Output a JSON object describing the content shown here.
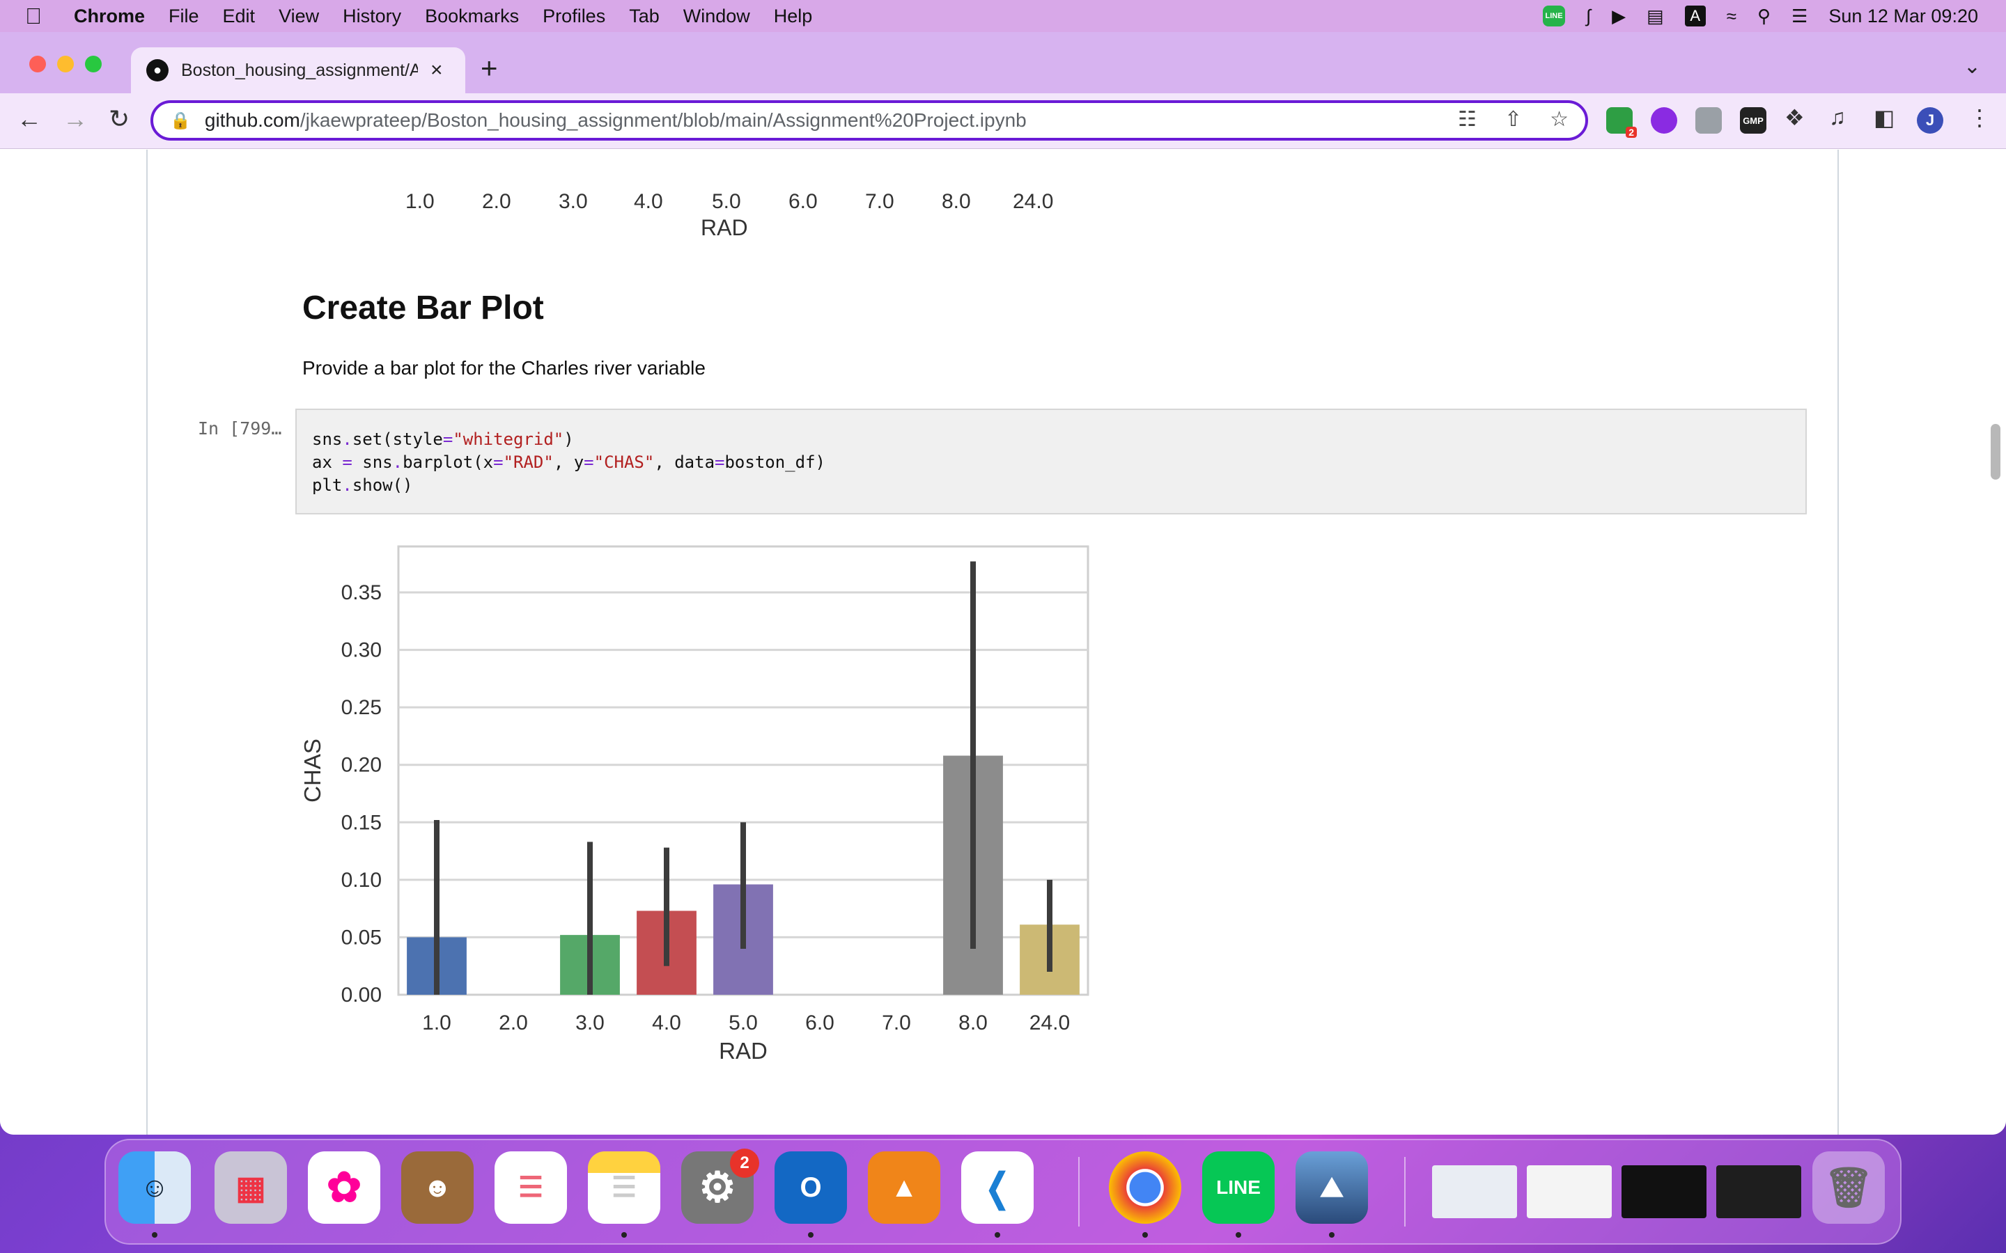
{
  "menubar": {
    "app": "Chrome",
    "items": [
      "File",
      "Edit",
      "View",
      "History",
      "Bookmarks",
      "Profiles",
      "Tab",
      "Window",
      "Help"
    ],
    "clock": "Sun 12 Mar  09:20"
  },
  "browser": {
    "tab_title": "Boston_housing_assignment/Assignment Project.ipynb",
    "url_host": "github.com",
    "url_path": "/jkaewprateep/Boston_housing_assignment/blob/main/Assignment%20Project.ipynb",
    "profile_initial": "J",
    "extension_badge": "2"
  },
  "notebook": {
    "prev_chart": {
      "x_ticks": [
        "1.0",
        "2.0",
        "3.0",
        "4.0",
        "5.0",
        "6.0",
        "7.0",
        "8.0",
        "24.0"
      ],
      "xlabel": "RAD"
    },
    "heading": "Create Bar Plot",
    "paragraph": "Provide a bar plot for the Charles river variable",
    "prompt": "In [799…",
    "code": {
      "line1": [
        "sns",
        ".",
        "set(style",
        "=",
        "\"whitegrid\"",
        ")"
      ],
      "line2": [
        "ax ",
        "=",
        " sns",
        ".",
        "barplot(x",
        "=",
        "\"RAD\"",
        ", y",
        "=",
        "\"CHAS\"",
        ", data",
        "=",
        "boston_df)"
      ],
      "line3": [
        "plt",
        ".",
        "show()"
      ]
    }
  },
  "chart_data": {
    "type": "bar",
    "categories": [
      "1.0",
      "2.0",
      "3.0",
      "4.0",
      "5.0",
      "6.0",
      "7.0",
      "8.0",
      "24.0"
    ],
    "values": [
      0.05,
      0.0,
      0.052,
      0.073,
      0.096,
      0.0,
      0.0,
      0.208,
      0.061
    ],
    "ci_low": [
      0.0,
      0.0,
      0.0,
      0.025,
      0.04,
      0.0,
      0.0,
      0.04,
      0.02
    ],
    "ci_high": [
      0.152,
      0.0,
      0.133,
      0.128,
      0.15,
      0.0,
      0.0,
      0.377,
      0.1
    ],
    "colors": [
      "#4c72b0",
      "#dd8452",
      "#55a868",
      "#c44e52",
      "#8172b3",
      "#937860",
      "#da8bc3",
      "#8c8c8c",
      "#ccb974"
    ],
    "y_ticks": [
      "0.00",
      "0.05",
      "0.10",
      "0.15",
      "0.20",
      "0.25",
      "0.30",
      "0.35"
    ],
    "xlabel": "RAD",
    "ylabel": "CHAS",
    "ylim": [
      0,
      0.39
    ],
    "grid": "horizontal"
  },
  "dock": {
    "apps": [
      "Finder",
      "Launchpad",
      "Photos",
      "Contacts",
      "Reminders",
      "Notes",
      "System Preferences",
      "Outlook",
      "Draw.io",
      "VS Code",
      "Chrome",
      "LINE",
      "Preview"
    ],
    "settings_badge": "2",
    "line_label": "LINE"
  }
}
